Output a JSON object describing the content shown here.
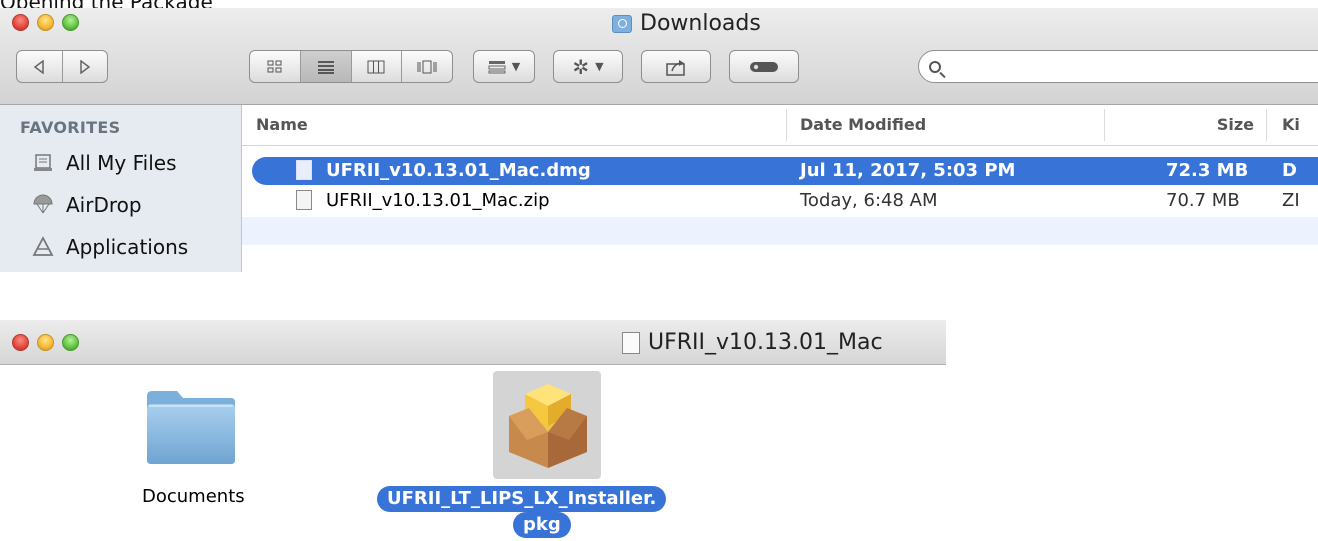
{
  "caption": "Opening the Package",
  "finder_downloads": {
    "title": "Downloads",
    "title_icon": "downloads-folder-icon",
    "toolbar": {
      "back_icon": "chevron-left-icon",
      "forward_icon": "chevron-right-icon",
      "view_icons": [
        "icon-view-icon",
        "list-view-icon",
        "column-view-icon",
        "cover-flow-icon"
      ],
      "arrange_icon": "arrange-icon",
      "action_icon": "gear-icon",
      "share_icon": "share-icon",
      "tags_icon": "tag-icon",
      "search_placeholder": ""
    },
    "sidebar": {
      "heading": "FAVORITES",
      "items": [
        {
          "label": "All My Files",
          "icon": "all-files-icon"
        },
        {
          "label": "AirDrop",
          "icon": "airdrop-icon"
        },
        {
          "label": "Applications",
          "icon": "applications-icon"
        }
      ]
    },
    "columns": [
      "Name",
      "Date Modified",
      "Size",
      "Ki"
    ],
    "rows": [
      {
        "name": "UFRII_v10.13.01_Mac.dmg",
        "date": "Jul 11, 2017, 5:03 PM",
        "size": "72.3 MB",
        "kind": "D",
        "selected": true
      },
      {
        "name": "UFRII_v10.13.01_Mac.zip",
        "date": "Today, 6:48 AM",
        "size": "70.7 MB",
        "kind": "ZI",
        "selected": false
      }
    ],
    "selection_color": "#3874d8"
  },
  "finder_volume": {
    "title": "UFRII_v10.13.01_Mac",
    "items": [
      {
        "label": "Documents",
        "icon": "folder-icon",
        "selected": false
      },
      {
        "label_line1": "UFRII_LT_LIPS_LX_Installer.",
        "label_line2": "pkg",
        "icon": "package-icon",
        "selected": true
      }
    ]
  }
}
